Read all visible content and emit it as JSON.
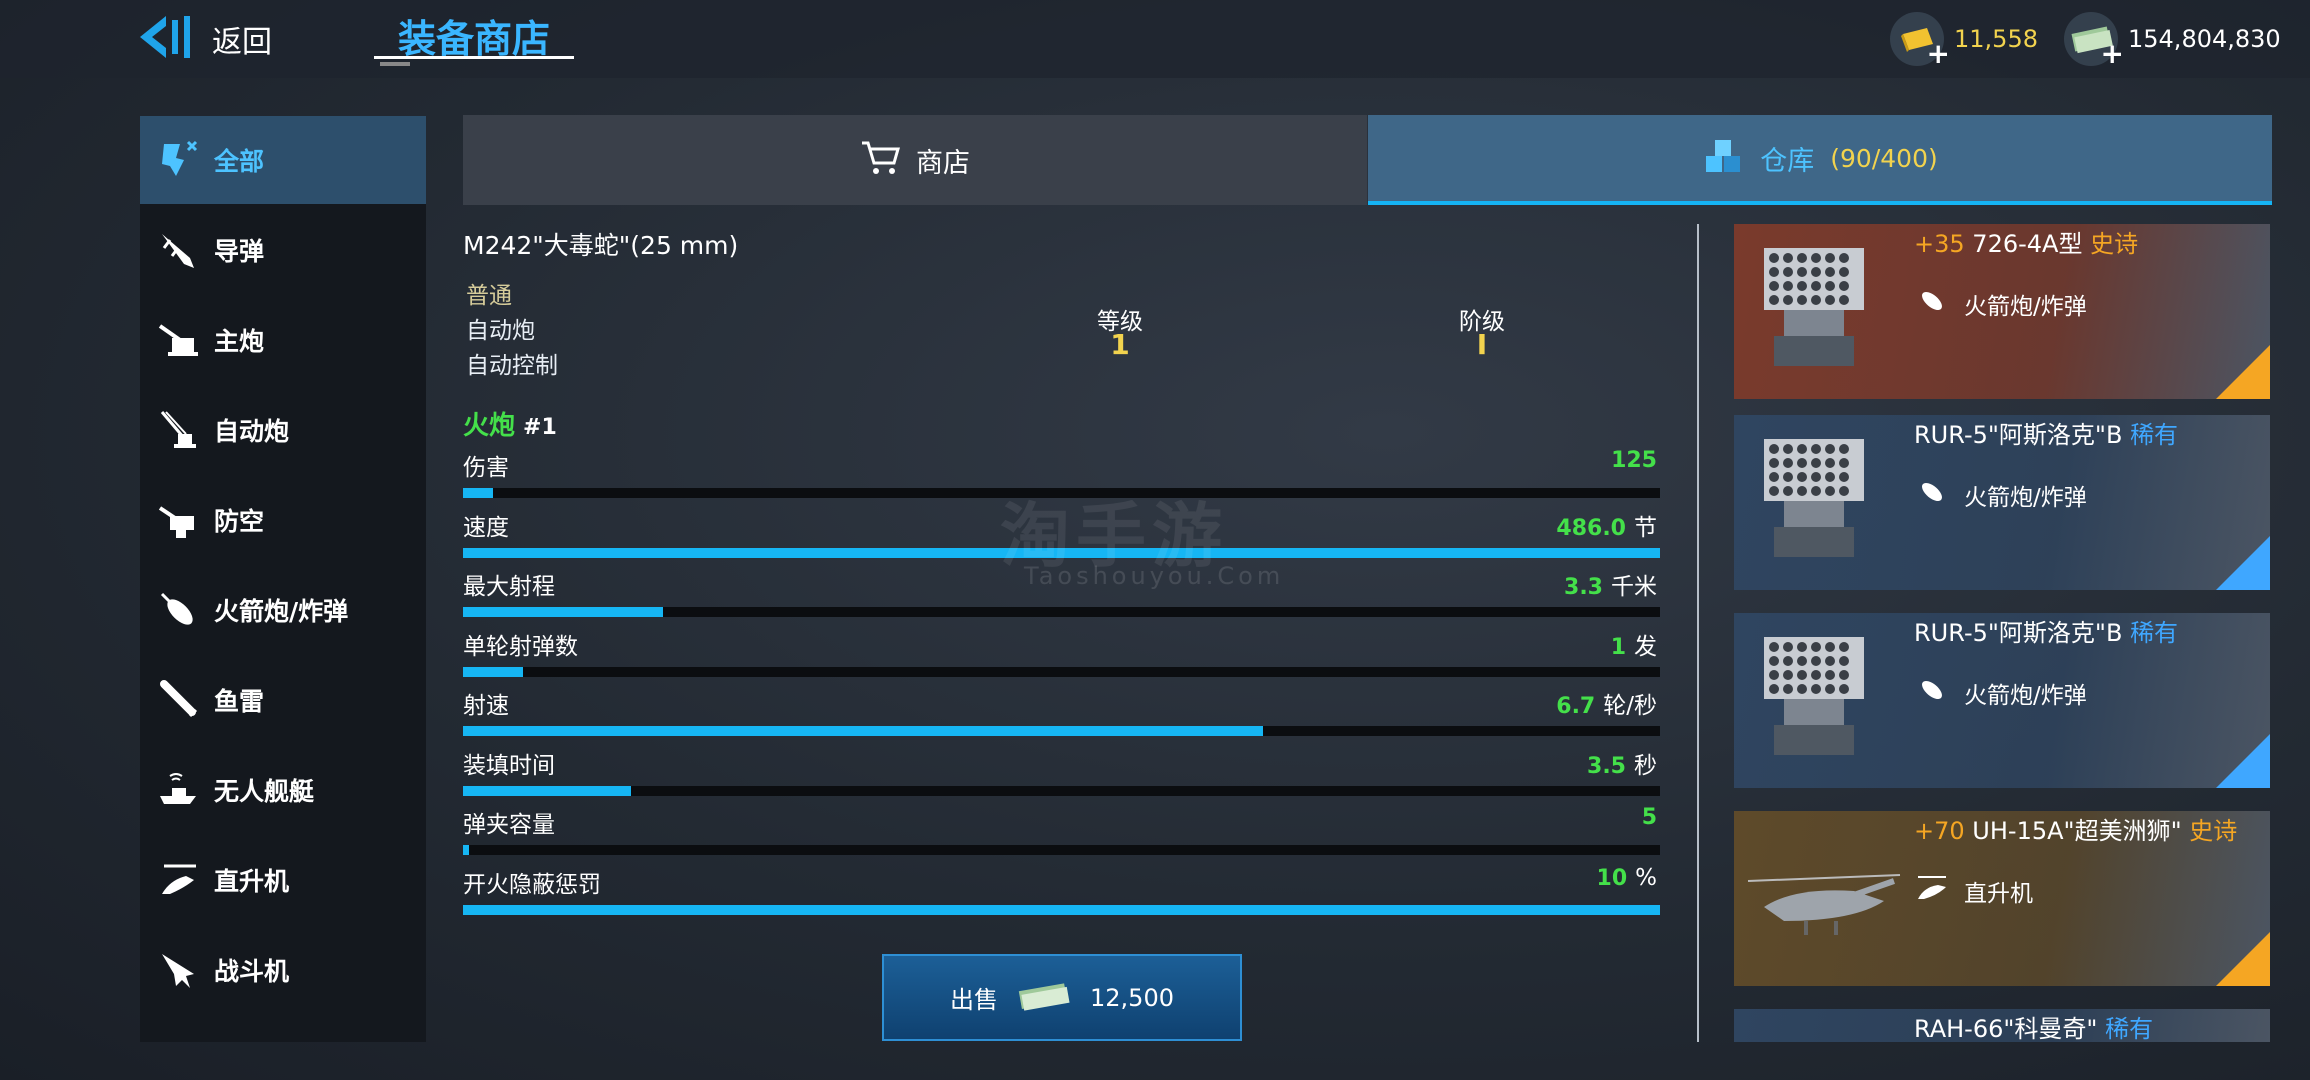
{
  "header": {
    "back_label": "返回",
    "title": "装备商店",
    "currency": [
      {
        "icon": "gold-bar-icon",
        "value": "11,558",
        "color": "#f2d34e"
      },
      {
        "icon": "cash-icon",
        "value": "154,804,830",
        "color": "#ffffff"
      }
    ]
  },
  "sidebar": {
    "items": [
      {
        "label": "全部",
        "icon": "all-icon",
        "active": true
      },
      {
        "label": "导弹",
        "icon": "missile-icon"
      },
      {
        "label": "主炮",
        "icon": "main-gun-icon"
      },
      {
        "label": "自动炮",
        "icon": "autocannon-icon"
      },
      {
        "label": "防空",
        "icon": "anti-air-icon"
      },
      {
        "label": "火箭炮/炸弹",
        "icon": "rocket-bomb-icon"
      },
      {
        "label": "鱼雷",
        "icon": "torpedo-icon"
      },
      {
        "label": "无人舰艇",
        "icon": "drone-boat-icon"
      },
      {
        "label": "直升机",
        "icon": "helicopter-icon"
      },
      {
        "label": "战斗机",
        "icon": "fighter-jet-icon"
      }
    ]
  },
  "tabs": {
    "shop": "商店",
    "warehouse": "仓库",
    "warehouse_count": "(90/400)"
  },
  "detail": {
    "name": "M242\"大毒蛇\"(25 mm)",
    "rarity": "普通",
    "category": "自动炮",
    "control": "自动控制",
    "level_label": "等级",
    "level_value": "1",
    "tier_label": "阶级",
    "tier_value": "I",
    "section_label": "火炮",
    "section_index": "#1",
    "stats": [
      {
        "label": "伤害",
        "value": "125",
        "unit": "",
        "fill": 0.025
      },
      {
        "label": "速度",
        "value": "486.0",
        "unit": "节",
        "fill": 1.0
      },
      {
        "label": "最大射程",
        "value": "3.3",
        "unit": "千米",
        "fill": 0.167
      },
      {
        "label": "单轮射弹数",
        "value": "1",
        "unit": "发",
        "fill": 0.05
      },
      {
        "label": "射速",
        "value": "6.7",
        "unit": "轮/秒",
        "fill": 0.668
      },
      {
        "label": "装填时间",
        "value": "3.5",
        "unit": "秒",
        "fill": 0.14
      },
      {
        "label": "弹夹容量",
        "value": "5",
        "unit": "",
        "fill": 0.005
      },
      {
        "label": "开火隐蔽惩罚",
        "value": "10",
        "unit": "%",
        "fill": 1.0
      }
    ],
    "sell_label": "出售",
    "sell_price": "12,500"
  },
  "inventory": [
    {
      "plus": "+35",
      "name": "726-4A型",
      "tier": "史诗",
      "tier_class": "epic",
      "type": "火箭炮/炸弹",
      "type_icon": "rocket-bomb-icon",
      "bg": "#7a3a2c",
      "corner": "#f5a623",
      "image": "launcher-icon"
    },
    {
      "plus": "",
      "name": "RUR-5\"阿斯洛克\"B",
      "tier": "稀有",
      "tier_class": "rare",
      "type": "火箭炮/炸弹",
      "type_icon": "rocket-bomb-icon",
      "bg": "#2f4560",
      "corner": "#3fa7ff",
      "image": "launcher-icon"
    },
    {
      "plus": "",
      "name": "RUR-5\"阿斯洛克\"B",
      "tier": "稀有",
      "tier_class": "rare",
      "type": "火箭炮/炸弹",
      "type_icon": "rocket-bomb-icon",
      "bg": "#2f4560",
      "corner": "#3fa7ff",
      "image": "launcher-icon"
    },
    {
      "plus": "+70",
      "name": "UH-15A\"超美洲狮\"",
      "tier": "史诗",
      "tier_class": "epic",
      "type": "直升机",
      "type_icon": "helicopter-icon",
      "bg": "#5e4a2a",
      "corner": "#f5a623",
      "image": "helicopter-icon"
    },
    {
      "plus": "",
      "name": "RAH-66\"科曼奇\"",
      "tier": "稀有",
      "tier_class": "rare",
      "type": "",
      "type_icon": "",
      "bg": "#2f4560",
      "corner": "#3fa7ff",
      "image": ""
    }
  ],
  "watermark": {
    "main": "淘手游",
    "sub": "Taoshouyou.Com"
  }
}
